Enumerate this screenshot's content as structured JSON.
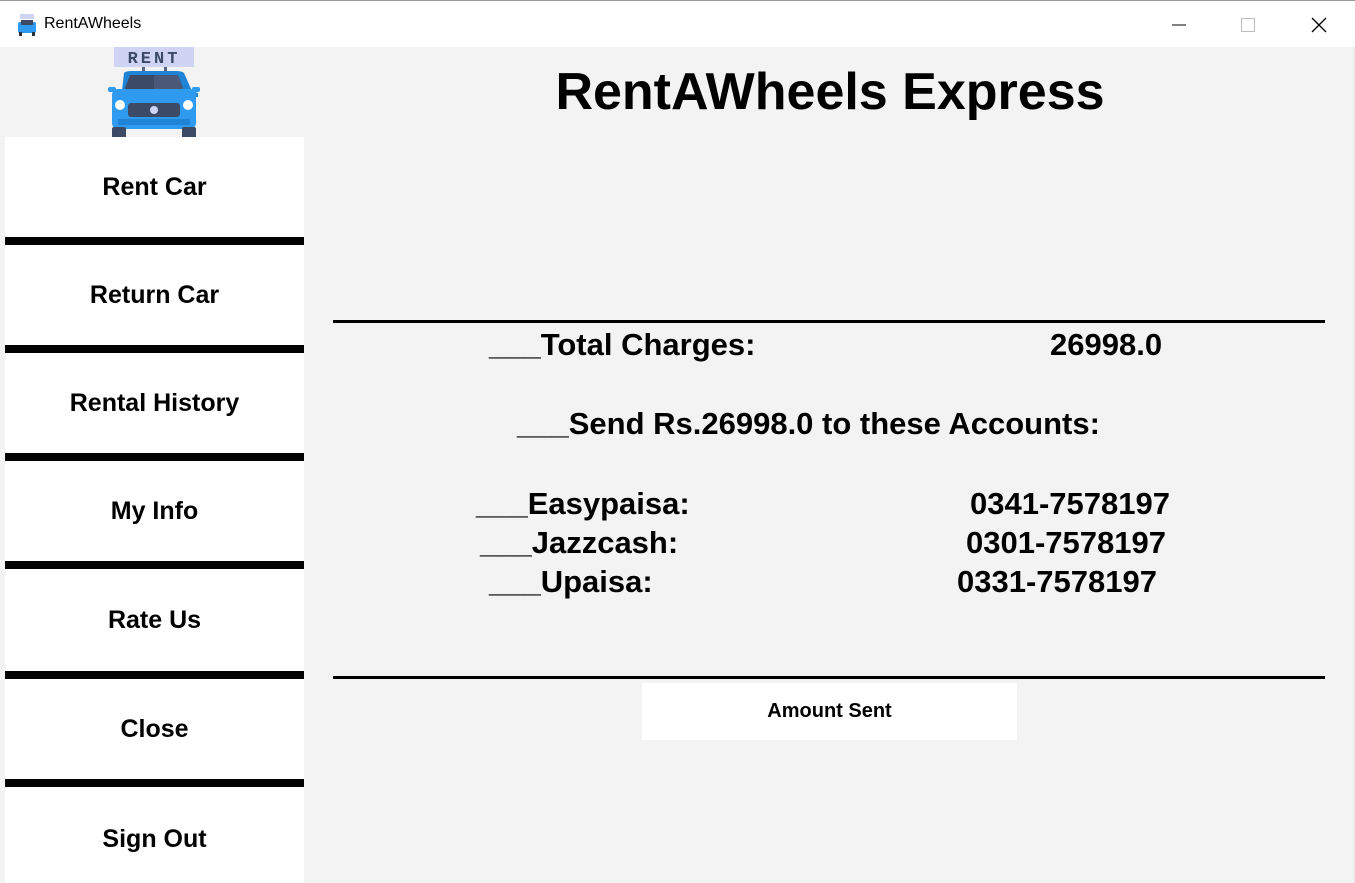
{
  "window": {
    "title": "RentAWheels",
    "app_icon": "car-icon",
    "controls": [
      "minimize-icon",
      "maximize-icon",
      "close-icon"
    ]
  },
  "logo": {
    "sign_text": "RENT",
    "icon": "car-rent-logo"
  },
  "sidebar": {
    "items": [
      {
        "label": "Rent Car"
      },
      {
        "label": "Return Car"
      },
      {
        "label": "Rental History"
      },
      {
        "label": "My Info"
      },
      {
        "label": "Rate Us"
      },
      {
        "label": "Close"
      },
      {
        "label": "Sign Out"
      }
    ]
  },
  "main": {
    "heading": "RentAWheels Express",
    "total_label": "___Total Charges:",
    "total_value": "26998.0",
    "send_text": "___Send Rs.26998.0 to these Accounts:",
    "accounts": [
      {
        "label": "___Easypaisa:",
        "number": "0341-7578197"
      },
      {
        "label": "___Jazzcash:",
        "number": "0301-7578197"
      },
      {
        "label": "___Upaisa:",
        "number": "0331-7578197"
      }
    ],
    "amount_button": "Amount Sent"
  },
  "colors": {
    "background": "#f3f3f3",
    "button_bg": "#ffffff",
    "separator": "#000000",
    "car_blue": "#2f9bf0",
    "rent_sign": "#cfd4f5"
  }
}
